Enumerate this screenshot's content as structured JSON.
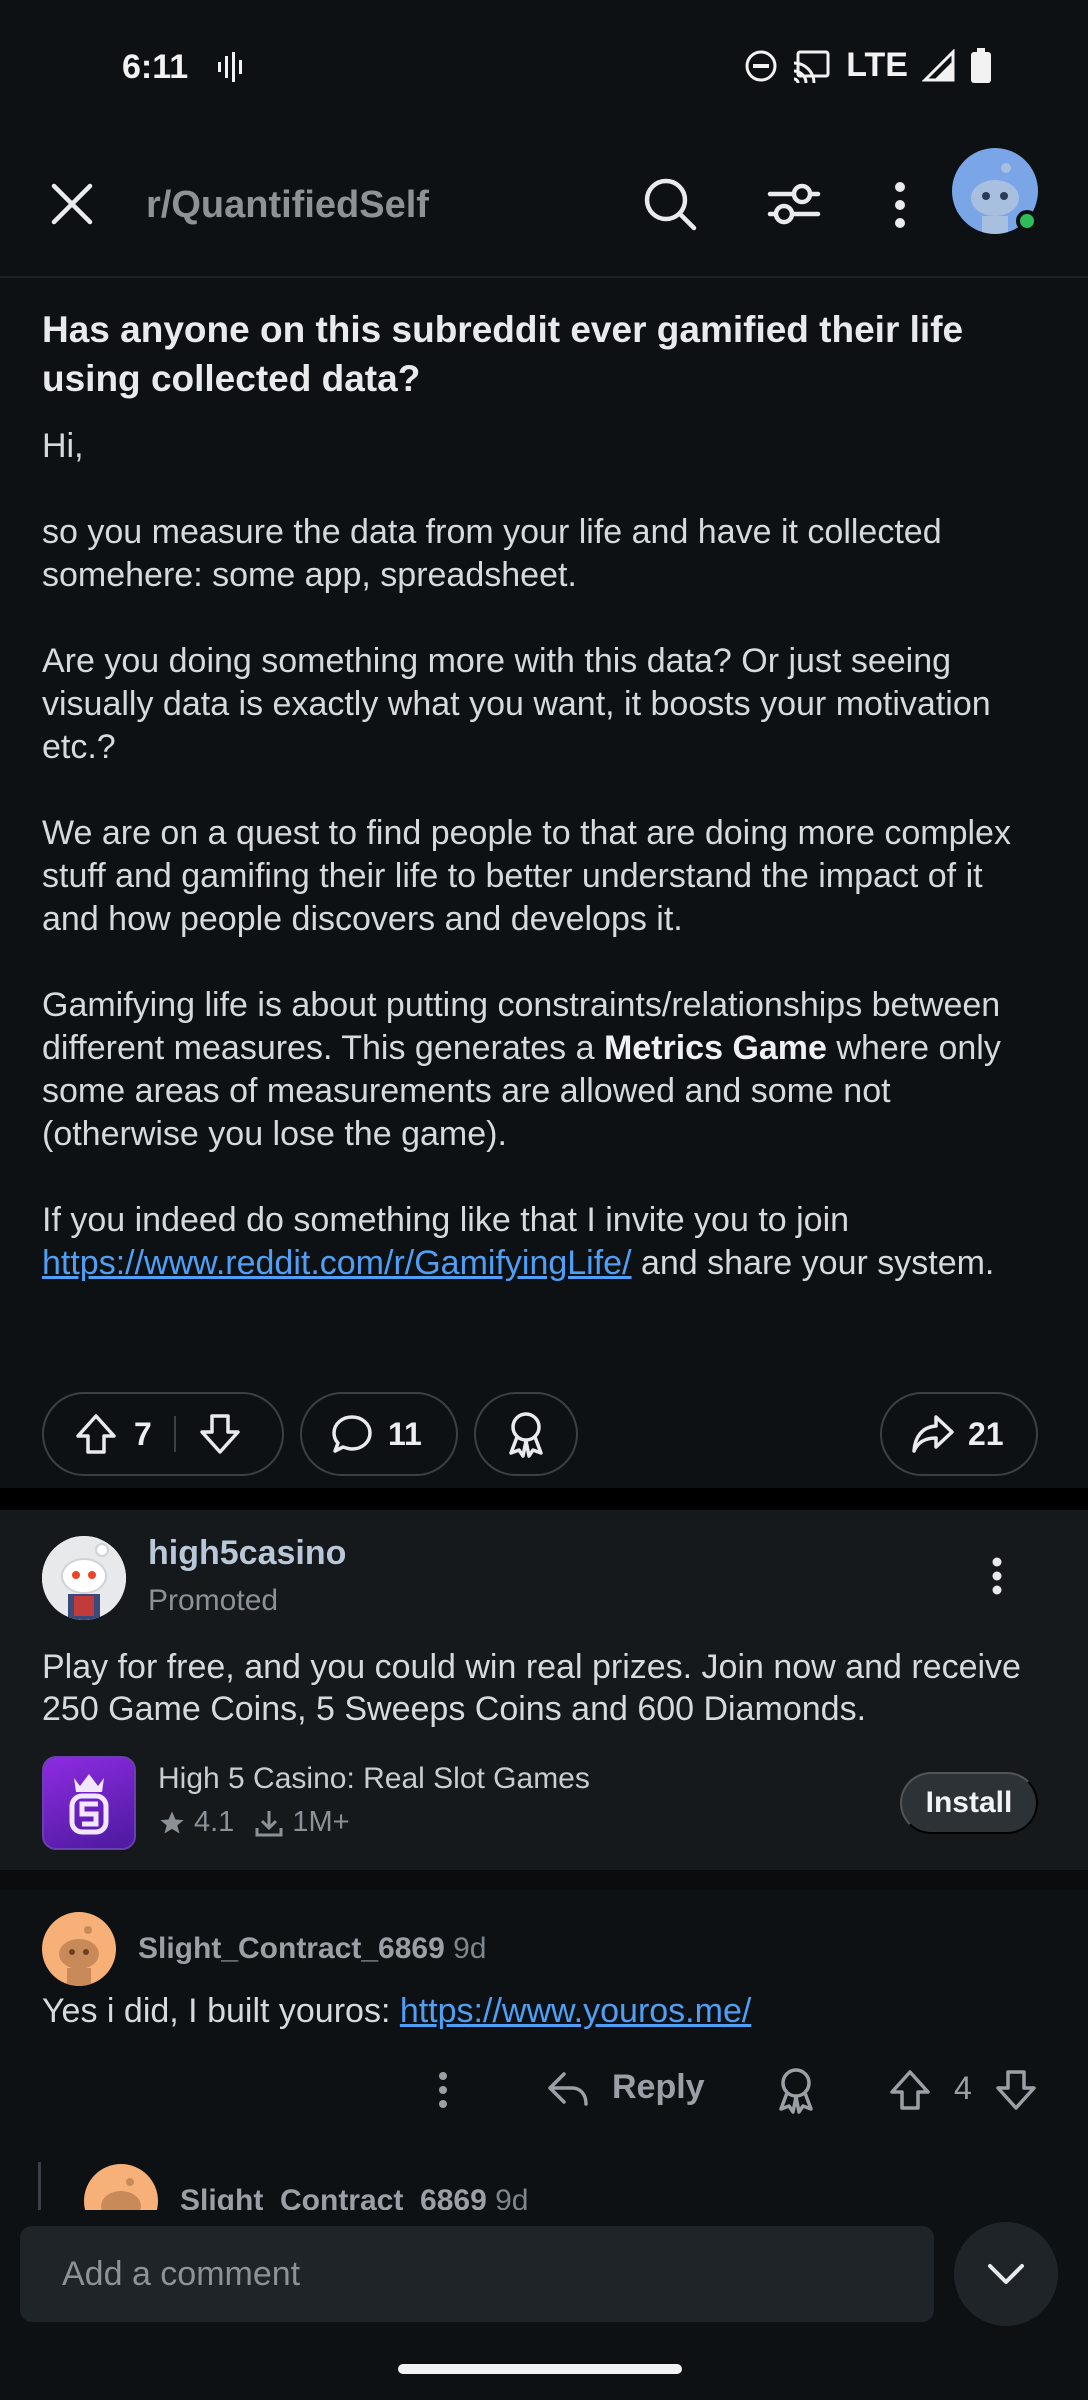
{
  "status_bar": {
    "time": "6:11",
    "network": "LTE"
  },
  "header": {
    "subreddit": "r/QuantifiedSelf"
  },
  "post": {
    "title": "Has anyone on this subreddit ever gamified their life using collected data?",
    "paragraphs": {
      "p1": "Hi,",
      "p2": "so you measure the data from your life and have it collected somehere: some app, spreadsheet.",
      "p3": "Are you doing something more with this data? Or just seeing visually data is exactly what you want, it boosts your motivation etc.?",
      "p4": "We are on a quest to find people to that are doing more complex stuff and gamifing their life to better understand the impact of it and how people discovers and develops it.",
      "p5_a": "Gamifying life is about putting constraints/relationships between different measures. This generates a ",
      "p5_bold": "Metrics Game",
      "p5_b": " where only some areas of measurements are allowed and some not (otherwise you lose the game).",
      "p6_a": "If you indeed do something like that I invite you to join ",
      "p6_link": "https://www.reddit.com/r/GamifyingLife/",
      "p6_b": " and share your system."
    },
    "upvotes": "7",
    "comments": "11",
    "shares": "21"
  },
  "ad": {
    "advertiser": "high5casino",
    "label": "Promoted",
    "text": "Play for free, and you could win real prizes. Join now and receive 250 Game Coins, 5 Sweeps Coins and 600 Diamonds.",
    "app_name": "High 5 Casino: Real Slot Games",
    "rating": "4.1",
    "downloads": "1M+",
    "install_label": "Install"
  },
  "comment": {
    "user": "Slight_Contract_6869",
    "age": "9d",
    "text": "Yes i did, I built youros: ",
    "link": "https://www.youros.me/",
    "reply_label": "Reply",
    "votes": "4"
  },
  "reply": {
    "user": "Slight_Contract_6869",
    "age": "9d"
  },
  "comment_bar": {
    "placeholder": "Add a comment"
  },
  "colors": {
    "background": "#0e1113",
    "link": "#4e9ff5",
    "online": "#2ebd59"
  }
}
